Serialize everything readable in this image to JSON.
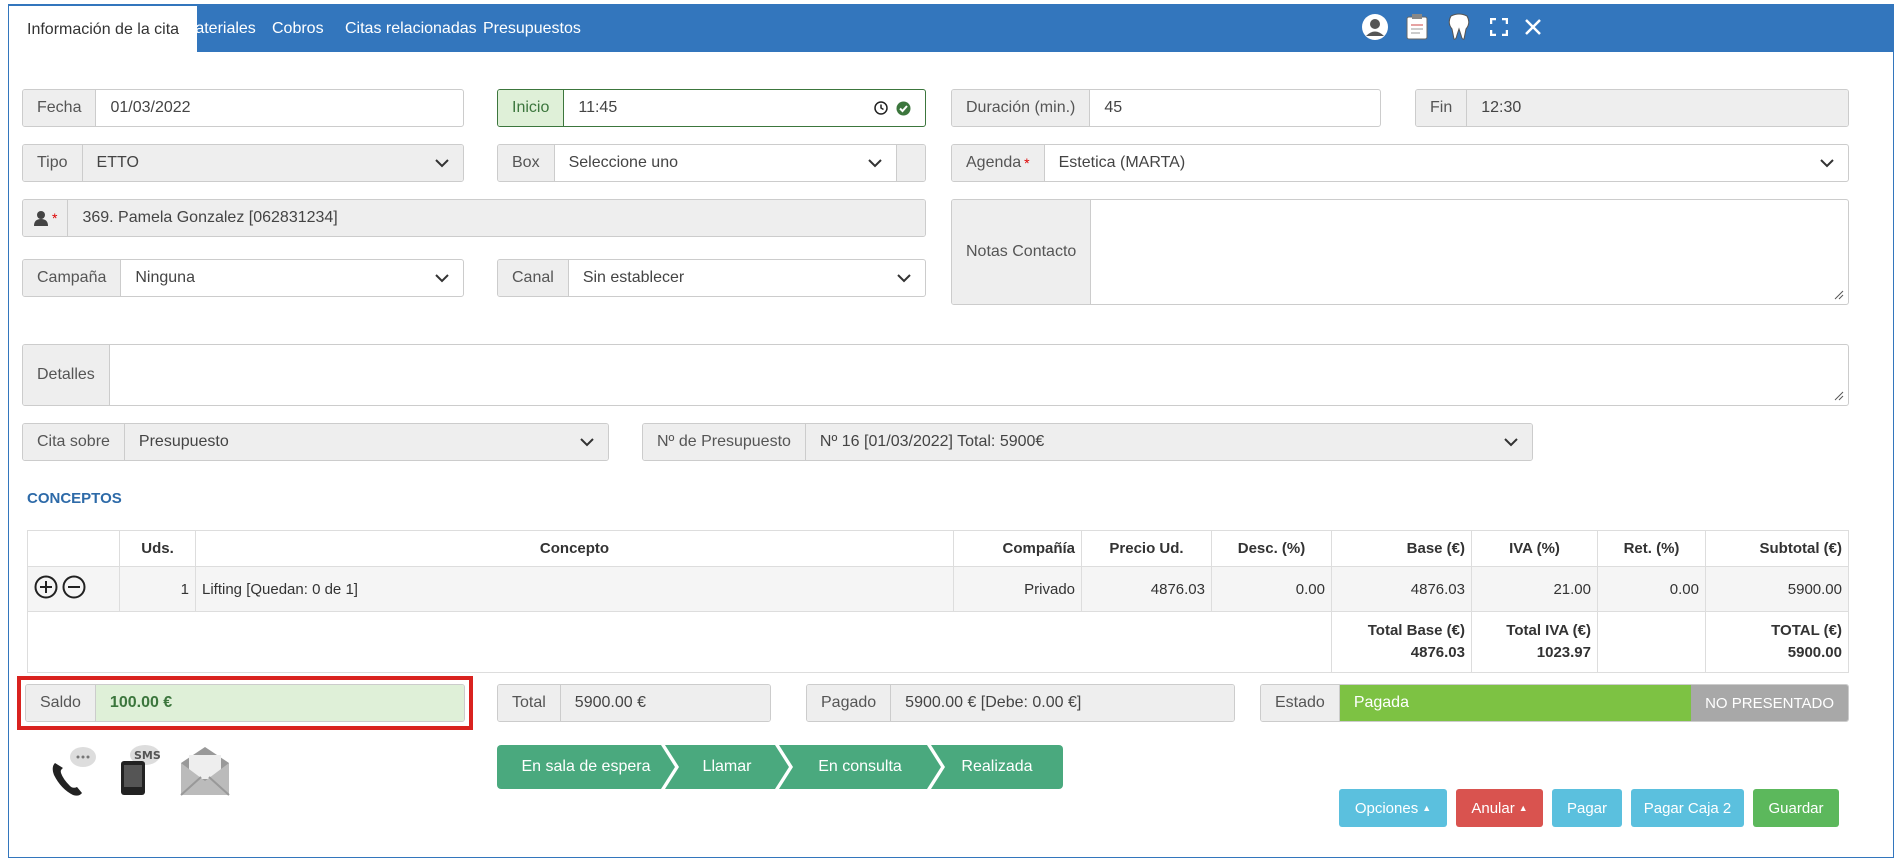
{
  "tabs": [
    "Información de la cita",
    "Materiales",
    "Cobros",
    "Citas relacionadas",
    "Presupuestos"
  ],
  "top_icons": [
    "user-icon",
    "clipboard-icon",
    "tooth-icon",
    "fullscreen-icon",
    "close-icon"
  ],
  "fecha": {
    "label": "Fecha",
    "value": "01/03/2022"
  },
  "inicio": {
    "label": "Inicio",
    "value": "11:45"
  },
  "duracion": {
    "label": "Duración (min.)",
    "value": "45"
  },
  "fin": {
    "label": "Fin",
    "value": "12:30"
  },
  "tipo": {
    "label": "Tipo",
    "value": "ETTO"
  },
  "box": {
    "label": "Box",
    "value": "Seleccione uno"
  },
  "agenda": {
    "label": "Agenda",
    "value": "Estetica (MARTA)"
  },
  "paciente": {
    "value": "369. Pamela Gonzalez [062831234]"
  },
  "notas": {
    "label": "Notas Contacto",
    "value": ""
  },
  "campana": {
    "label": "Campaña",
    "value": "Ninguna"
  },
  "canal": {
    "label": "Canal",
    "value": "Sin establecer"
  },
  "detalles": {
    "label": "Detalles",
    "value": ""
  },
  "cita_sobre": {
    "label": "Cita sobre",
    "value": "Presupuesto"
  },
  "presupuesto": {
    "label": "Nº de Presupuesto",
    "value": "Nº 16 [01/03/2022] Total: 5900€"
  },
  "conceptos_title": "CONCEPTOS",
  "table": {
    "headers": [
      "",
      "Uds.",
      "Concepto",
      "Compañía",
      "Precio Ud.",
      "Desc. (%)",
      "Base (€)",
      "IVA (%)",
      "Ret. (%)",
      "Subtotal (€)"
    ],
    "rows": [
      [
        "",
        "1",
        "Lifting [Quedan: 0 de 1]",
        "Privado",
        "4876.03",
        "0.00",
        "4876.03",
        "21.00",
        "0.00",
        "5900.00"
      ]
    ],
    "totals": {
      "base_label": "Total Base (€)",
      "base": "4876.03",
      "iva_label": "Total IVA (€)",
      "iva": "1023.97",
      "total_label": "TOTAL (€)",
      "total": "5900.00"
    }
  },
  "saldo": {
    "label": "Saldo",
    "value": "100.00 €"
  },
  "total": {
    "label": "Total",
    "value": "5900.00 €"
  },
  "pagado": {
    "label": "Pagado",
    "value": "5900.00 € [Debe: 0.00 €]"
  },
  "estado": {
    "label": "Estado",
    "value": "Pagada",
    "no_presentado": "NO PRESENTADO"
  },
  "steps": [
    "En sala de espera",
    "Llamar",
    "En consulta",
    "Realizada"
  ],
  "buttons": {
    "opciones": "Opciones",
    "anular": "Anular",
    "pagar": "Pagar",
    "pagar_caja": "Pagar Caja 2",
    "guardar": "Guardar"
  },
  "colors": {
    "primary": "#3376bd",
    "success": "#5cb85c",
    "step": "#4aa97e",
    "info": "#5bc0de",
    "danger": "#d9534f",
    "estado": "#7dc243",
    "highlight": "#d9221f"
  }
}
